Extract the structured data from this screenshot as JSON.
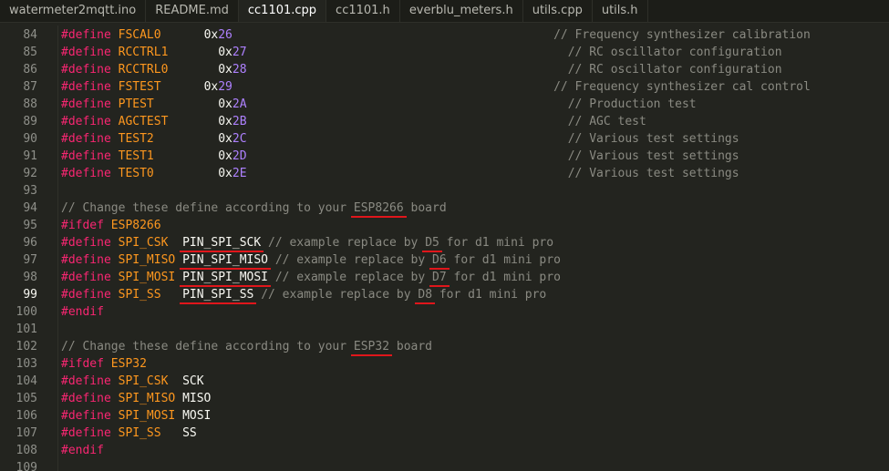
{
  "tabs": [
    {
      "label": "watermeter2mqtt.ino",
      "active": false
    },
    {
      "label": "README.md",
      "active": false
    },
    {
      "label": "cc1101.cpp",
      "active": true
    },
    {
      "label": "cc1101.h",
      "active": false
    },
    {
      "label": "everblu_meters.h",
      "active": false
    },
    {
      "label": "utils.cpp",
      "active": false
    },
    {
      "label": "utils.h",
      "active": false
    }
  ],
  "line_numbers": [
    "84",
    "85",
    "86",
    "87",
    "88",
    "89",
    "90",
    "91",
    "92",
    "93",
    "94",
    "95",
    "96",
    "97",
    "98",
    "99",
    "100",
    "101",
    "102",
    "103",
    "104",
    "105",
    "106",
    "107",
    "108",
    "109"
  ],
  "current_line": "99",
  "code": [
    [
      {
        "t": "kw",
        "v": "#define"
      },
      {
        "t": "pl",
        "v": " "
      },
      {
        "t": "nm",
        "v": "FSCAL0"
      },
      {
        "t": "pl",
        "v": "      "
      },
      {
        "t": "pl",
        "v": "0x"
      },
      {
        "t": "hx",
        "v": "26"
      },
      {
        "t": "pl",
        "v": "                                             "
      },
      {
        "t": "cm",
        "v": "// Frequency synthesizer calibration"
      }
    ],
    [
      {
        "t": "kw",
        "v": "#define"
      },
      {
        "t": "pl",
        "v": " "
      },
      {
        "t": "nm",
        "v": "RCCTRL1"
      },
      {
        "t": "pl",
        "v": "       "
      },
      {
        "t": "pl",
        "v": "0x"
      },
      {
        "t": "hx",
        "v": "27"
      },
      {
        "t": "pl",
        "v": "                                             "
      },
      {
        "t": "cm",
        "v": "// RC oscillator configuration"
      }
    ],
    [
      {
        "t": "kw",
        "v": "#define"
      },
      {
        "t": "pl",
        "v": " "
      },
      {
        "t": "nm",
        "v": "RCCTRL0"
      },
      {
        "t": "pl",
        "v": "       "
      },
      {
        "t": "pl",
        "v": "0x"
      },
      {
        "t": "hx",
        "v": "28"
      },
      {
        "t": "pl",
        "v": "                                             "
      },
      {
        "t": "cm",
        "v": "// RC oscillator configuration"
      }
    ],
    [
      {
        "t": "kw",
        "v": "#define"
      },
      {
        "t": "pl",
        "v": " "
      },
      {
        "t": "nm",
        "v": "FSTEST"
      },
      {
        "t": "pl",
        "v": "      "
      },
      {
        "t": "pl",
        "v": "0x"
      },
      {
        "t": "hx",
        "v": "29"
      },
      {
        "t": "pl",
        "v": "                                             "
      },
      {
        "t": "cm",
        "v": "// Frequency synthesizer cal control"
      }
    ],
    [
      {
        "t": "kw",
        "v": "#define"
      },
      {
        "t": "pl",
        "v": " "
      },
      {
        "t": "nm",
        "v": "PTEST"
      },
      {
        "t": "pl",
        "v": "         "
      },
      {
        "t": "pl",
        "v": "0x"
      },
      {
        "t": "hx",
        "v": "2A"
      },
      {
        "t": "pl",
        "v": "                                             "
      },
      {
        "t": "cm",
        "v": "// Production test"
      }
    ],
    [
      {
        "t": "kw",
        "v": "#define"
      },
      {
        "t": "pl",
        "v": " "
      },
      {
        "t": "nm",
        "v": "AGCTEST"
      },
      {
        "t": "pl",
        "v": "       "
      },
      {
        "t": "pl",
        "v": "0x"
      },
      {
        "t": "hx",
        "v": "2B"
      },
      {
        "t": "pl",
        "v": "                                             "
      },
      {
        "t": "cm",
        "v": "// AGC test"
      }
    ],
    [
      {
        "t": "kw",
        "v": "#define"
      },
      {
        "t": "pl",
        "v": " "
      },
      {
        "t": "nm",
        "v": "TEST2"
      },
      {
        "t": "pl",
        "v": "         "
      },
      {
        "t": "pl",
        "v": "0x"
      },
      {
        "t": "hx",
        "v": "2C"
      },
      {
        "t": "pl",
        "v": "                                             "
      },
      {
        "t": "cm",
        "v": "// Various test settings"
      }
    ],
    [
      {
        "t": "kw",
        "v": "#define"
      },
      {
        "t": "pl",
        "v": " "
      },
      {
        "t": "nm",
        "v": "TEST1"
      },
      {
        "t": "pl",
        "v": "         "
      },
      {
        "t": "pl",
        "v": "0x"
      },
      {
        "t": "hx",
        "v": "2D"
      },
      {
        "t": "pl",
        "v": "                                             "
      },
      {
        "t": "cm",
        "v": "// Various test settings"
      }
    ],
    [
      {
        "t": "kw",
        "v": "#define"
      },
      {
        "t": "pl",
        "v": " "
      },
      {
        "t": "nm",
        "v": "TEST0"
      },
      {
        "t": "pl",
        "v": "         "
      },
      {
        "t": "pl",
        "v": "0x"
      },
      {
        "t": "hx",
        "v": "2E"
      },
      {
        "t": "pl",
        "v": "                                             "
      },
      {
        "t": "cm",
        "v": "// Various test settings"
      }
    ],
    [],
    [
      {
        "t": "cm",
        "v": "// Change these define according to your "
      },
      {
        "t": "cm",
        "v": "ESP8266",
        "u": true
      },
      {
        "t": "cm",
        "v": " board"
      }
    ],
    [
      {
        "t": "kw",
        "v": "#ifdef"
      },
      {
        "t": "pl",
        "v": " "
      },
      {
        "t": "nm",
        "v": "ESP8266"
      }
    ],
    [
      {
        "t": "kw",
        "v": "#define"
      },
      {
        "t": "pl",
        "v": " "
      },
      {
        "t": "nm",
        "v": "SPI_CSK"
      },
      {
        "t": "pl",
        "v": "  "
      },
      {
        "t": "pl",
        "v": "PIN_SPI_SCK",
        "u": true
      },
      {
        "t": "pl",
        "v": " "
      },
      {
        "t": "cm",
        "v": "// example replace by "
      },
      {
        "t": "cm",
        "v": "D5",
        "u": true
      },
      {
        "t": "cm",
        "v": " for d1 mini pro"
      }
    ],
    [
      {
        "t": "kw",
        "v": "#define"
      },
      {
        "t": "pl",
        "v": " "
      },
      {
        "t": "nm",
        "v": "SPI_MISO"
      },
      {
        "t": "pl",
        "v": " "
      },
      {
        "t": "pl",
        "v": "PIN_SPI_MISO",
        "u": true
      },
      {
        "t": "pl",
        "v": " "
      },
      {
        "t": "cm",
        "v": "// example replace by "
      },
      {
        "t": "cm",
        "v": "D6",
        "u": true
      },
      {
        "t": "cm",
        "v": " for d1 mini pro"
      }
    ],
    [
      {
        "t": "kw",
        "v": "#define"
      },
      {
        "t": "pl",
        "v": " "
      },
      {
        "t": "nm",
        "v": "SPI_MOSI"
      },
      {
        "t": "pl",
        "v": " "
      },
      {
        "t": "pl",
        "v": "PIN_SPI_MOSI",
        "u": true
      },
      {
        "t": "pl",
        "v": " "
      },
      {
        "t": "cm",
        "v": "// example replace by "
      },
      {
        "t": "cm",
        "v": "D7",
        "u": true
      },
      {
        "t": "cm",
        "v": " for d1 mini pro"
      }
    ],
    [
      {
        "t": "kw",
        "v": "#define"
      },
      {
        "t": "pl",
        "v": " "
      },
      {
        "t": "nm",
        "v": "SPI_SS"
      },
      {
        "t": "pl",
        "v": "   "
      },
      {
        "t": "pl",
        "v": "PIN_SPI_SS",
        "u": true
      },
      {
        "t": "pl",
        "v": " "
      },
      {
        "t": "cm",
        "v": "// example replace by "
      },
      {
        "t": "cm",
        "v": "D8",
        "u": true
      },
      {
        "t": "cm",
        "v": " for d1 mini pro"
      }
    ],
    [
      {
        "t": "kw",
        "v": "#endif"
      }
    ],
    [],
    [
      {
        "t": "cm",
        "v": "// Change these define according to your "
      },
      {
        "t": "cm",
        "v": "ESP32",
        "u": true
      },
      {
        "t": "cm",
        "v": " board"
      }
    ],
    [
      {
        "t": "kw",
        "v": "#ifdef"
      },
      {
        "t": "pl",
        "v": " "
      },
      {
        "t": "nm",
        "v": "ESP32"
      }
    ],
    [
      {
        "t": "kw",
        "v": "#define"
      },
      {
        "t": "pl",
        "v": " "
      },
      {
        "t": "nm",
        "v": "SPI_CSK"
      },
      {
        "t": "pl",
        "v": "  "
      },
      {
        "t": "pl",
        "v": "SCK"
      }
    ],
    [
      {
        "t": "kw",
        "v": "#define"
      },
      {
        "t": "pl",
        "v": " "
      },
      {
        "t": "nm",
        "v": "SPI_MISO"
      },
      {
        "t": "pl",
        "v": " "
      },
      {
        "t": "pl",
        "v": "MISO"
      }
    ],
    [
      {
        "t": "kw",
        "v": "#define"
      },
      {
        "t": "pl",
        "v": " "
      },
      {
        "t": "nm",
        "v": "SPI_MOSI"
      },
      {
        "t": "pl",
        "v": " "
      },
      {
        "t": "pl",
        "v": "MOSI"
      }
    ],
    [
      {
        "t": "kw",
        "v": "#define"
      },
      {
        "t": "pl",
        "v": " "
      },
      {
        "t": "nm",
        "v": "SPI_SS"
      },
      {
        "t": "pl",
        "v": "   "
      },
      {
        "t": "pl",
        "v": "SS"
      }
    ],
    [
      {
        "t": "kw",
        "v": "#endif"
      }
    ],
    []
  ],
  "colors": {
    "background": "#23241f",
    "keyword": "#f92672",
    "identifier": "#fd971f",
    "hex_digits": "#ae81ff",
    "comment": "#8a8a82",
    "plain": "#f8f8f2",
    "annotation_underline": "#e0161b"
  }
}
